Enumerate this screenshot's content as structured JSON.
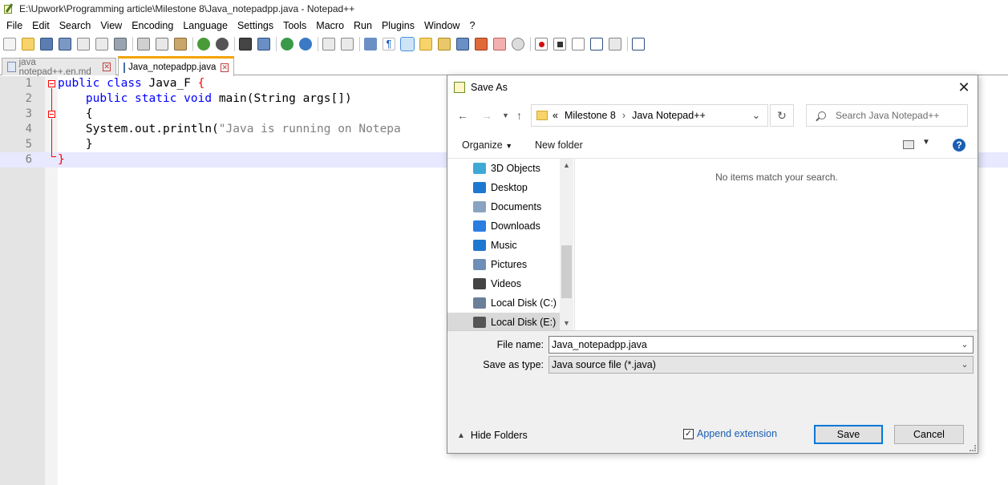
{
  "window": {
    "title": "E:\\Upwork\\Programming article\\Milestone 8\\Java_notepadpp.java - Notepad++"
  },
  "menu": [
    "File",
    "Edit",
    "Search",
    "View",
    "Encoding",
    "Language",
    "Settings",
    "Tools",
    "Macro",
    "Run",
    "Plugins",
    "Window",
    "?"
  ],
  "tabs": [
    {
      "label": "java notepad++.en.md",
      "active": false
    },
    {
      "label": "Java_notepadpp.java",
      "active": true
    }
  ],
  "editor": {
    "lines": [
      {
        "num": "1",
        "parts": [
          [
            "kw",
            "public"
          ],
          [
            "",
            " "
          ],
          [
            "kw",
            "class"
          ],
          [
            "",
            " Java_F "
          ],
          [
            "brace",
            "{"
          ]
        ]
      },
      {
        "num": "2",
        "parts": [
          [
            "",
            "    "
          ],
          [
            "kw",
            "public"
          ],
          [
            "",
            " "
          ],
          [
            "kw",
            "static"
          ],
          [
            "",
            " "
          ],
          [
            "kw",
            "void"
          ],
          [
            "",
            " main(String args[])"
          ]
        ]
      },
      {
        "num": "3",
        "parts": [
          [
            "",
            "    {"
          ]
        ]
      },
      {
        "num": "4",
        "parts": [
          [
            "",
            "    System.out.println("
          ],
          [
            "str",
            "\"Java is running on Notepa"
          ]
        ]
      },
      {
        "num": "5",
        "parts": [
          [
            "",
            "    }"
          ]
        ]
      },
      {
        "num": "6",
        "parts": [
          [
            "brace",
            "}"
          ]
        ]
      }
    ]
  },
  "dialog": {
    "title": "Save As",
    "breadcrumb": {
      "prefix": "«",
      "items": [
        "Milestone 8",
        "Java Notepad++"
      ]
    },
    "search_placeholder": "Search Java Notepad++",
    "organize": "Organize",
    "new_folder": "New folder",
    "help": "?",
    "tree": [
      {
        "label": "3D Objects",
        "icon": "3d-objects-icon",
        "color": "#3fa9d6"
      },
      {
        "label": "Desktop",
        "icon": "desktop-icon",
        "color": "#1e78d2"
      },
      {
        "label": "Documents",
        "icon": "documents-icon",
        "color": "#8aa3c2"
      },
      {
        "label": "Downloads",
        "icon": "downloads-icon",
        "color": "#2a7de1"
      },
      {
        "label": "Music",
        "icon": "music-icon",
        "color": "#1e78d2"
      },
      {
        "label": "Pictures",
        "icon": "pictures-icon",
        "color": "#6e8fb5"
      },
      {
        "label": "Videos",
        "icon": "videos-icon",
        "color": "#444444"
      },
      {
        "label": "Local Disk (C:)",
        "icon": "local-disk-c-icon",
        "color": "#6a7f99"
      },
      {
        "label": "Local Disk (E:)",
        "icon": "local-disk-e-icon",
        "color": "#555555",
        "selected": true
      }
    ],
    "empty_text": "No items match your search.",
    "file_name_label": "File name:",
    "file_name_value": "Java_notepadpp.java",
    "save_type_label": "Save as type:",
    "save_type_value": "Java source file (*.java)",
    "hide_folders": "Hide Folders",
    "append_extension": "Append extension",
    "append_checked": true,
    "save_button": "Save",
    "cancel_button": "Cancel"
  },
  "colors": {
    "keyword": "#8000ff",
    "string": "#808080",
    "brace": "#ff0000",
    "accent": "#0078d7",
    "tab_active_top": "#f4a300"
  }
}
